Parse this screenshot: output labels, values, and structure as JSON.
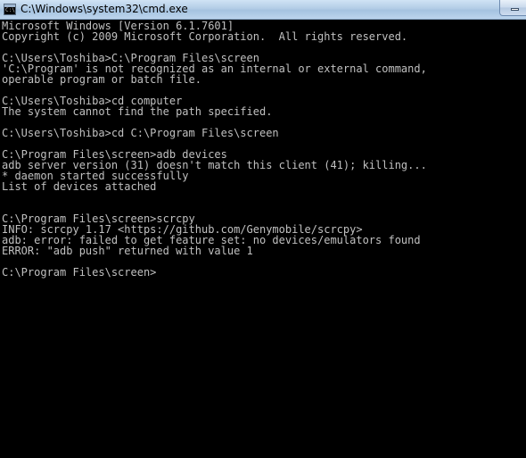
{
  "window": {
    "title": "C:\\Windows\\system32\\cmd.exe",
    "icon": "cmd-icon",
    "icon_glyph": "C:\\"
  },
  "console": {
    "lines": [
      "Microsoft Windows [Version 6.1.7601]",
      "Copyright (c) 2009 Microsoft Corporation.  All rights reserved.",
      "",
      "C:\\Users\\Toshiba>C:\\Program Files\\screen",
      "'C:\\Program' is not recognized as an internal or external command,",
      "operable program or batch file.",
      "",
      "C:\\Users\\Toshiba>cd computer",
      "The system cannot find the path specified.",
      "",
      "C:\\Users\\Toshiba>cd C:\\Program Files\\screen",
      "",
      "C:\\Program Files\\screen>adb devices",
      "adb server version (31) doesn't match this client (41); killing...",
      "* daemon started successfully",
      "List of devices attached",
      "",
      "",
      "C:\\Program Files\\screen>scrcpy",
      "INFO: scrcpy 1.17 <https://github.com/Genymobile/scrcpy>",
      "adb: error: failed to get feature set: no devices/emulators found",
      "ERROR: \"adb push\" returned with value 1",
      "",
      "C:\\Program Files\\screen>"
    ]
  }
}
